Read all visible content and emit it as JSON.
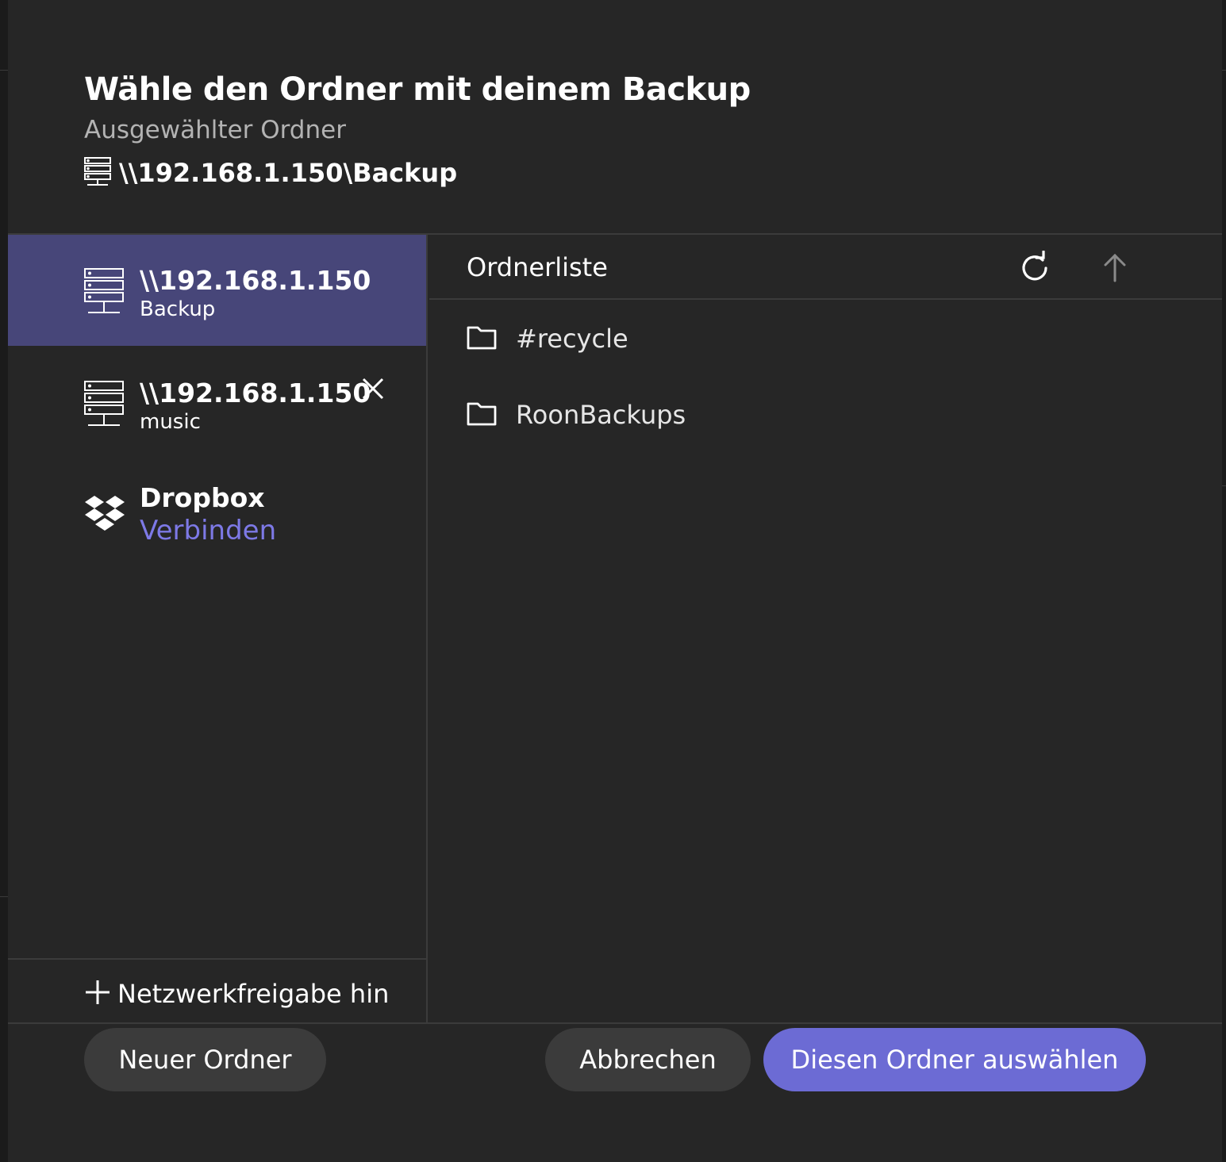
{
  "dialog": {
    "title": "Wähle den Ordner mit deinem Backup",
    "subtitle": "Ausgewählter Ordner",
    "selected_path": "\\\\192.168.1.150\\Backup",
    "selected_path_icon": "server-icon"
  },
  "shares": [
    {
      "host": "\\\\192.168.1.150",
      "name": "Backup",
      "icon": "server-icon",
      "selected": true
    },
    {
      "host": "\\\\192.168.1.150",
      "name": "music",
      "icon": "server-icon",
      "selected": false,
      "removable": true,
      "remove_icon": "close-icon"
    }
  ],
  "dropbox": {
    "title": "Dropbox",
    "link": "Verbinden",
    "icon": "dropbox-icon"
  },
  "add_share": {
    "label": "Netzwerkfreigabe hinzufügen",
    "icon": "plus-icon"
  },
  "folder_list": {
    "title": "Ordnerliste",
    "refresh_icon": "refresh-icon",
    "up_icon": "arrow-up-icon",
    "folders": [
      {
        "name": "#recycle",
        "icon": "folder-icon"
      },
      {
        "name": "RoonBackups",
        "icon": "folder-icon"
      }
    ]
  },
  "buttons": {
    "new_folder": "Neuer Ordner",
    "cancel": "Abbrechen",
    "select": "Diesen Ordner auswählen"
  },
  "colors": {
    "background": "#262626",
    "selected_item": "#474679",
    "accent": "#6c6bd4",
    "link": "#7d79e6",
    "secondary_button": "#3b3b3b"
  }
}
